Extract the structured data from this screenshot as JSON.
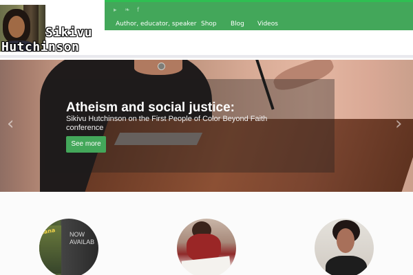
{
  "site": {
    "logo_first": "Sikivu",
    "logo_last": "Hutchinson"
  },
  "nav": {
    "items": [
      {
        "label": "Author, educator, speaker"
      },
      {
        "label": "Shop"
      },
      {
        "label": "Blog"
      },
      {
        "label": "Videos"
      }
    ],
    "social": [
      {
        "icon": "rss-icon",
        "glyph": "▸"
      },
      {
        "icon": "twitter-icon",
        "glyph": "❧"
      },
      {
        "icon": "facebook-icon",
        "glyph": "f"
      }
    ]
  },
  "hero": {
    "title": "Atheism and social justice:",
    "subtitle": "Sikivu Hutchinson on the First People of Color Beyond Faith conference",
    "button_label": "See more",
    "prev_glyph": "‹",
    "next_glyph": "›"
  },
  "features": {
    "book": {
      "title_text": "cana",
      "now_text": "NOW AVAILAB"
    }
  },
  "colors": {
    "accent": "#43a75a",
    "accent_top": "#2fbf52"
  }
}
